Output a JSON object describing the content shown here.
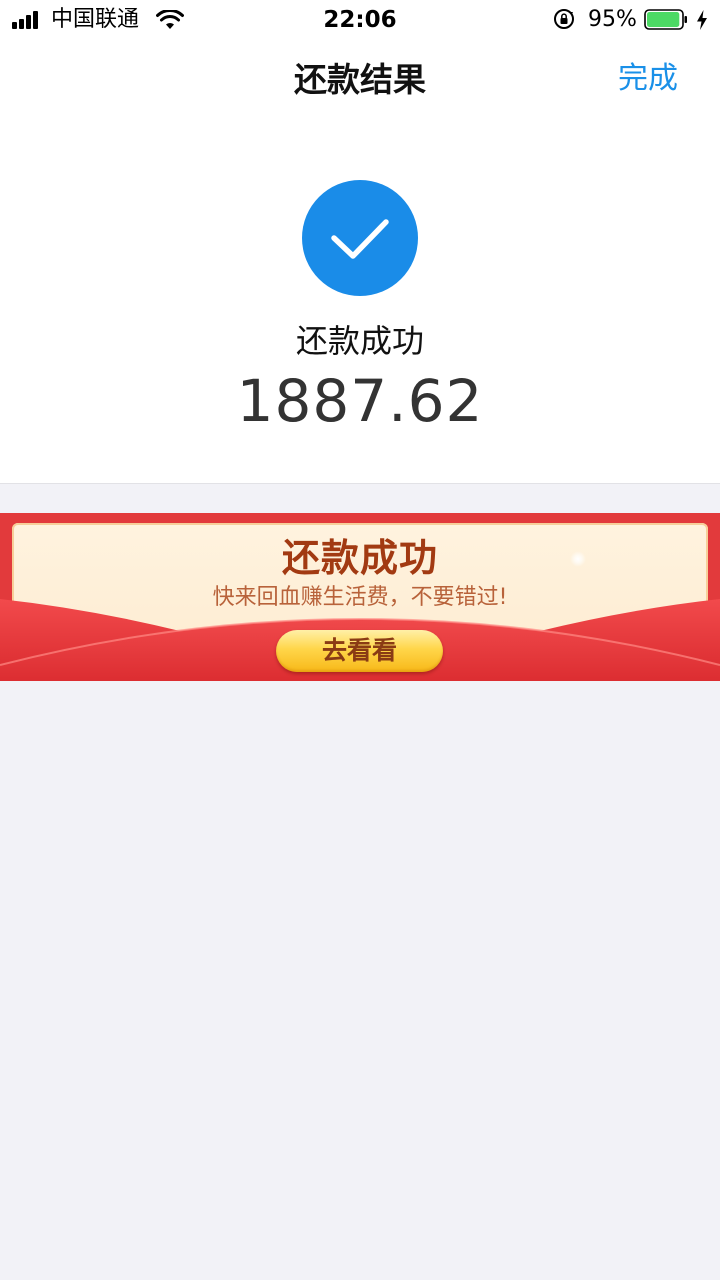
{
  "status_bar": {
    "carrier": "中国联通",
    "time": "22:06",
    "battery_percent": "95%",
    "battery_level": 0.95,
    "signal_bars": 4
  },
  "nav": {
    "title": "还款结果",
    "done_label": "完成"
  },
  "result": {
    "status": "还款成功",
    "amount": "1887.62",
    "icon": "check-circle-icon"
  },
  "promo": {
    "title": "还款成功",
    "subtitle": "快来回血赚生活费，不要错过!",
    "button_label": "去看看"
  },
  "colors": {
    "accent_blue": "#1a8ce8",
    "link_blue": "#1a90e8",
    "banner_red": "#e23a3c",
    "banner_title": "#a23a12",
    "page_background": "#f2f2f7"
  }
}
